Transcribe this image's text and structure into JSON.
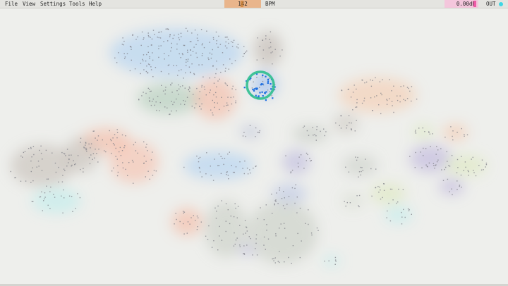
{
  "menu": {
    "items": [
      "File",
      "View",
      "Settings",
      "Tools",
      "Help"
    ]
  },
  "transport": {
    "bpm_value": "142",
    "bpm_label": "BPM",
    "gain_value": "0.00dB",
    "output_label": "OUT"
  },
  "colors": {
    "bpm_field": "#e9b58c",
    "gain_field": "#f4c6dc",
    "output_indicator": "#3fd6e4",
    "selection_ring": "#2fbf8f",
    "selected_points": "#1f6fe0",
    "background": "#eeefec"
  },
  "icons": [
    "output-status-dot-icon"
  ]
}
